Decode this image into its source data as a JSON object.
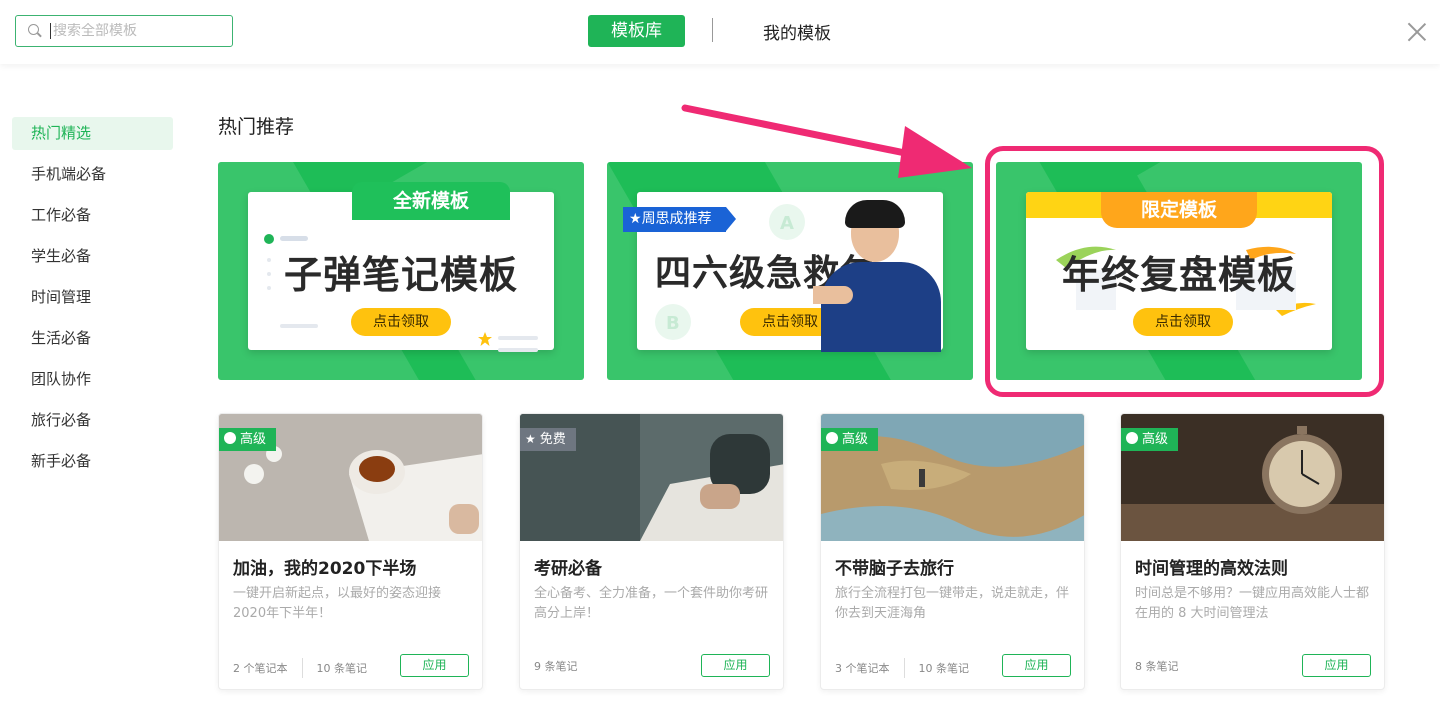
{
  "header": {
    "search_placeholder": "搜索全部模板",
    "tab_library": "模板库",
    "tab_mine": "我的模板"
  },
  "sidebar": {
    "items": [
      {
        "label": "热门精选",
        "active": true
      },
      {
        "label": "手机端必备"
      },
      {
        "label": "工作必备"
      },
      {
        "label": "学生必备"
      },
      {
        "label": "时间管理"
      },
      {
        "label": "生活必备"
      },
      {
        "label": "团队协作"
      },
      {
        "label": "旅行必备"
      },
      {
        "label": "新手必备"
      }
    ]
  },
  "section_title": "热门推荐",
  "banners": [
    {
      "ribbon": "全新模板",
      "title": "子弹笔记模板",
      "button": "点击领取"
    },
    {
      "tag": "周思成推荐",
      "title": "四六级急救包",
      "button": "点击领取"
    },
    {
      "ribbon": "限定模板",
      "title": "年终复盘模板",
      "button": "点击领取"
    }
  ],
  "cards": [
    {
      "badge": "高级",
      "title": "加油，我的2020下半场",
      "desc": "一键开启新起点，以最好的姿态迎接2020年下半年！",
      "meta": [
        "2 个笔记本",
        "10 条笔记"
      ],
      "button": "应用"
    },
    {
      "badge": "免费",
      "title": "考研必备",
      "desc": "全心备考、全力准备，一个套件助你考研高分上岸！",
      "meta": [
        "9 条笔记"
      ],
      "button": "应用"
    },
    {
      "badge": "高级",
      "title": "不带脑子去旅行",
      "desc": "旅行全流程打包一键带走，说走就走，伴你去到天涯海角",
      "meta": [
        "3 个笔记本",
        "10 条笔记"
      ],
      "button": "应用"
    },
    {
      "badge": "高级",
      "title": "时间管理的高效法则",
      "desc": "时间总是不够用？一键应用高效能人士都在用的 8 大时间管理法",
      "meta": [
        "8 条笔记"
      ],
      "button": "应用"
    }
  ],
  "colors": {
    "brand_green": "#1fb457",
    "highlight_pink": "#ef2a73",
    "accent_yellow": "#ffc20e"
  }
}
